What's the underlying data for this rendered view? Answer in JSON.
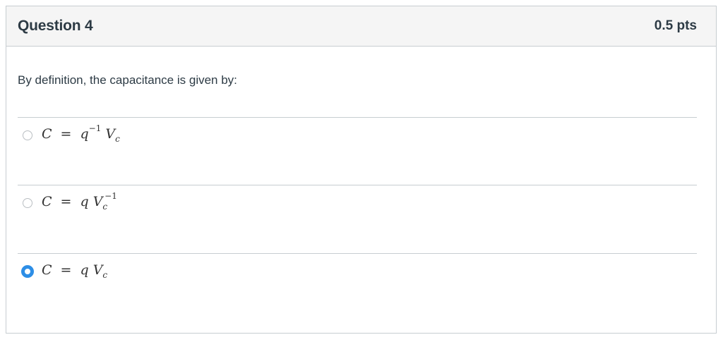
{
  "question": {
    "title": "Question 4",
    "points": "0.5 pts",
    "prompt": "By definition, the capacitance is given by:"
  },
  "answers": [
    {
      "lhs": "C",
      "eq": "=",
      "a": "q",
      "a_sup": "−1",
      "b": "V",
      "b_sub": "c",
      "b_sup": "",
      "selected": false
    },
    {
      "lhs": "C",
      "eq": "=",
      "a": "q",
      "a_sup": "",
      "b": "V",
      "b_sub": "c",
      "b_sup": "−1",
      "selected": false
    },
    {
      "lhs": "C",
      "eq": "=",
      "a": "q",
      "a_sup": "",
      "b": "V",
      "b_sub": "c",
      "b_sup": "",
      "selected": true
    }
  ],
  "colors": {
    "accent": "#2d8ee6",
    "border": "#c7cdd1",
    "header_bg": "#f5f5f5",
    "text": "#2d3b45"
  }
}
